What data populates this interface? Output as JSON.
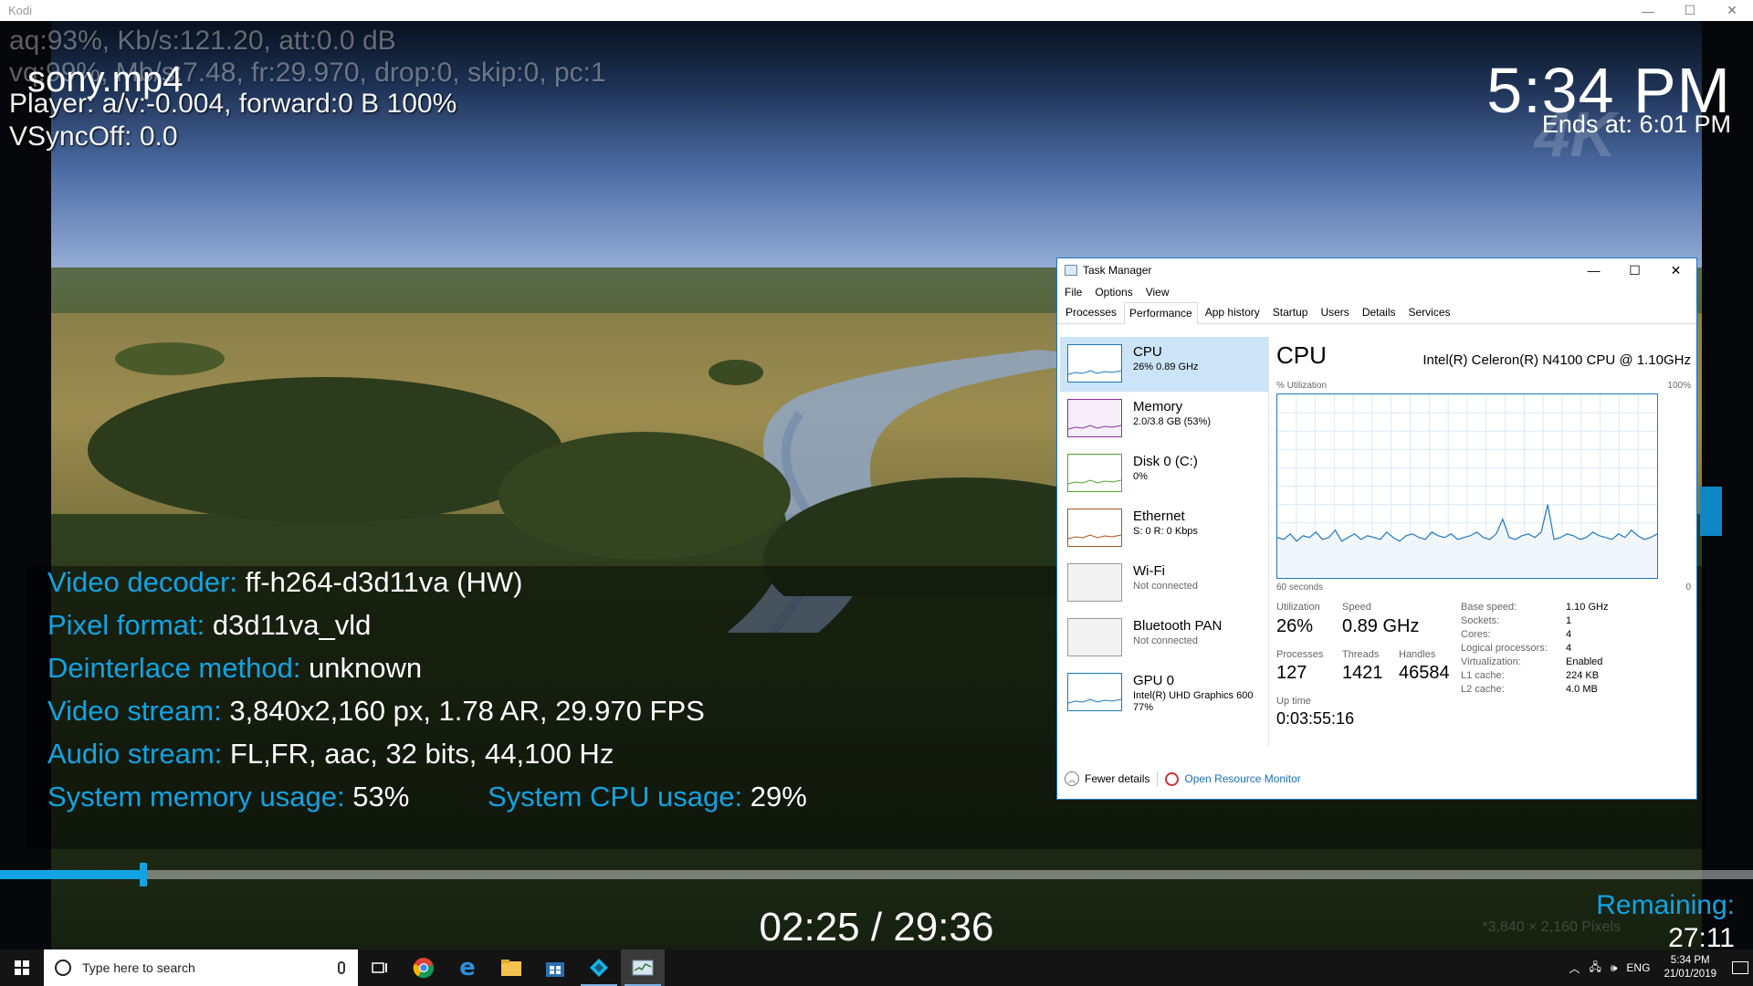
{
  "window": {
    "title": "Kodi",
    "controls": [
      "—",
      "☐",
      "✕"
    ]
  },
  "osd": {
    "filename": "sony.mp4",
    "debug_lines": [
      "aq:93%, Kb/s:121.20, att:0.0 dB",
      "vq:99%, Mb/s:7.48, fr:29.970, drop:0, skip:0, pc:1",
      "Player: a/v:-0.004,  forward:0 B 100%",
      "VSyncOff: 0.0"
    ],
    "clock": "5:34 PM",
    "ends_at": "Ends at: 6:01 PM",
    "badge": "4K",
    "info": [
      {
        "label": "Video decoder:",
        "value": "ff-h264-d3d11va (HW)"
      },
      {
        "label": "Pixel format:",
        "value": "d3d11va_vld"
      },
      {
        "label": "Deinterlace method:",
        "value": "unknown"
      },
      {
        "label": "Video stream:",
        "value": "3,840x2,160 px, 1.78 AR, 29.970 FPS"
      },
      {
        "label": "Audio stream:",
        "value": "FL,FR, aac, 32 bits, 44,100 Hz"
      }
    ],
    "mem_label": "System memory usage:",
    "mem_value": "53%",
    "cpu_label": "System CPU usage:",
    "cpu_value": "29%",
    "progress_fraction": 0.082,
    "time": "02:25 / 29:36",
    "remaining_label": "Remaining:",
    "remaining_value": "27:11",
    "pixels_ghost": "*3,840 × 2,160 Pixels",
    "accent": "#12a3e2"
  },
  "taskmgr": {
    "title": "Task Manager",
    "menu": [
      "File",
      "Options",
      "View"
    ],
    "tabs": [
      "Processes",
      "Performance",
      "App history",
      "Startup",
      "Users",
      "Details",
      "Services"
    ],
    "active_tab": "Performance",
    "resources": [
      {
        "name": "CPU",
        "sub": "26% 0.89 GHz",
        "color": "#1a78c2",
        "selected": true
      },
      {
        "name": "Memory",
        "sub": "2.0/3.8 GB (53%)",
        "color": "#8b2da0"
      },
      {
        "name": "Disk 0 (C:)",
        "sub": "0%",
        "color": "#4da62b"
      },
      {
        "name": "Ethernet",
        "sub": "S: 0 R: 0 Kbps",
        "color": "#a7551a"
      },
      {
        "name": "Wi-Fi",
        "sub": "Not connected",
        "color": "#999999",
        "gray": true
      },
      {
        "name": "Bluetooth PAN",
        "sub": "Not connected",
        "color": "#999999",
        "gray": true
      },
      {
        "name": "GPU 0",
        "sub": "Intel(R) UHD Graphics 600\n77%",
        "color": "#1a78c2"
      }
    ],
    "cpu": {
      "title": "CPU",
      "model": "Intel(R) Celeron(R) N4100 CPU @ 1.10GHz",
      "util_label": "% Utilization",
      "util_max": "100%",
      "graph_left": "60 seconds",
      "graph_right": "0",
      "stats": {
        "utilization_label": "Utilization",
        "utilization": "26%",
        "speed_label": "Speed",
        "speed": "0.89 GHz",
        "processes_label": "Processes",
        "processes": "127",
        "threads_label": "Threads",
        "threads": "1421",
        "handles_label": "Handles",
        "handles": "46584",
        "uptime_label": "Up time",
        "uptime": "0:03:55:16"
      },
      "specs": [
        {
          "k": "Base speed:",
          "v": "1.10 GHz"
        },
        {
          "k": "Sockets:",
          "v": "1"
        },
        {
          "k": "Cores:",
          "v": "4"
        },
        {
          "k": "Logical processors:",
          "v": "4"
        },
        {
          "k": "Virtualization:",
          "v": "Enabled"
        },
        {
          "k": "L1 cache:",
          "v": "224 KB"
        },
        {
          "k": "L2 cache:",
          "v": "4.0 MB"
        }
      ],
      "history": [
        22,
        21,
        24,
        20,
        23,
        22,
        25,
        21,
        22,
        26,
        20,
        22,
        24,
        21,
        23,
        22,
        21,
        25,
        22,
        20,
        23,
        24,
        22,
        21,
        25,
        23,
        22,
        24,
        21,
        22,
        23,
        25,
        22,
        21,
        24,
        32,
        22,
        21,
        23,
        24,
        22,
        25,
        40,
        21,
        22,
        24,
        23,
        21,
        22,
        25,
        23,
        22,
        21,
        24,
        22,
        26,
        23,
        21,
        22,
        24
      ]
    },
    "footer_fewer": "Fewer details",
    "footer_monitor": "Open Resource Monitor"
  },
  "taskbar": {
    "search_placeholder": "Type here to search",
    "lang": "ENG",
    "time": "5:34 PM",
    "date": "21/01/2019"
  }
}
